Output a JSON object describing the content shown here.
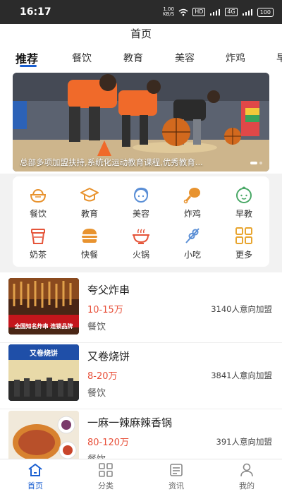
{
  "statusbar": {
    "time": "16:17",
    "net_speed_top": "1.00",
    "net_speed_unit": "KB/S",
    "hd_label": "HD",
    "signal_label": "4G",
    "battery": "100"
  },
  "header": {
    "title": "首页"
  },
  "tabs": [
    {
      "label": "推荐"
    },
    {
      "label": "餐饮"
    },
    {
      "label": "教育"
    },
    {
      "label": "美容"
    },
    {
      "label": "炸鸡"
    },
    {
      "label": "早"
    }
  ],
  "banner": {
    "caption": "总部多项加盟扶持,系统化运动教育课程,优秀教育..."
  },
  "categories": [
    {
      "label": "餐饮",
      "icon": "rice-bowl-icon",
      "color": "#e8932f"
    },
    {
      "label": "教育",
      "icon": "graduation-cap-icon",
      "color": "#e8932f"
    },
    {
      "label": "美容",
      "icon": "woman-face-icon",
      "color": "#5b8fd6"
    },
    {
      "label": "炸鸡",
      "icon": "chicken-leg-icon",
      "color": "#e8932f"
    },
    {
      "label": "早教",
      "icon": "baby-face-icon",
      "color": "#4aa867"
    },
    {
      "label": "奶茶",
      "icon": "milk-tea-cup-icon",
      "color": "#e5553a"
    },
    {
      "label": "快餐",
      "icon": "burger-icon",
      "color": "#e8932f"
    },
    {
      "label": "火锅",
      "icon": "hotpot-icon",
      "color": "#e5553a"
    },
    {
      "label": "小吃",
      "icon": "skewer-icon",
      "color": "#5b8fd6"
    },
    {
      "label": "更多",
      "icon": "grid-more-icon",
      "color": "#e8a52f"
    }
  ],
  "list": [
    {
      "name": "夸父炸串",
      "price": "10-15万",
      "intent": "3140人意向加盟",
      "tag": "餐饮",
      "thumb_text": "全国知名炸串 连锁品牌"
    },
    {
      "name": "又卷烧饼",
      "price": "8-20万",
      "intent": "3841人意向加盟",
      "tag": "餐饮",
      "thumb_text": "又卷烧饼"
    },
    {
      "name": "一麻一辣麻辣香锅",
      "price": "80-120万",
      "intent": "391人意向加盟",
      "tag": "餐饮",
      "thumb_text": ""
    }
  ],
  "bottomnav": [
    {
      "label": "首页",
      "icon": "home-icon",
      "active": true
    },
    {
      "label": "分类",
      "icon": "category-grid-icon",
      "active": false
    },
    {
      "label": "资讯",
      "icon": "news-icon",
      "active": false
    },
    {
      "label": "我的",
      "icon": "user-icon",
      "active": false
    }
  ],
  "colors": {
    "accent": "#1a5fd1",
    "price": "#e8503a"
  }
}
